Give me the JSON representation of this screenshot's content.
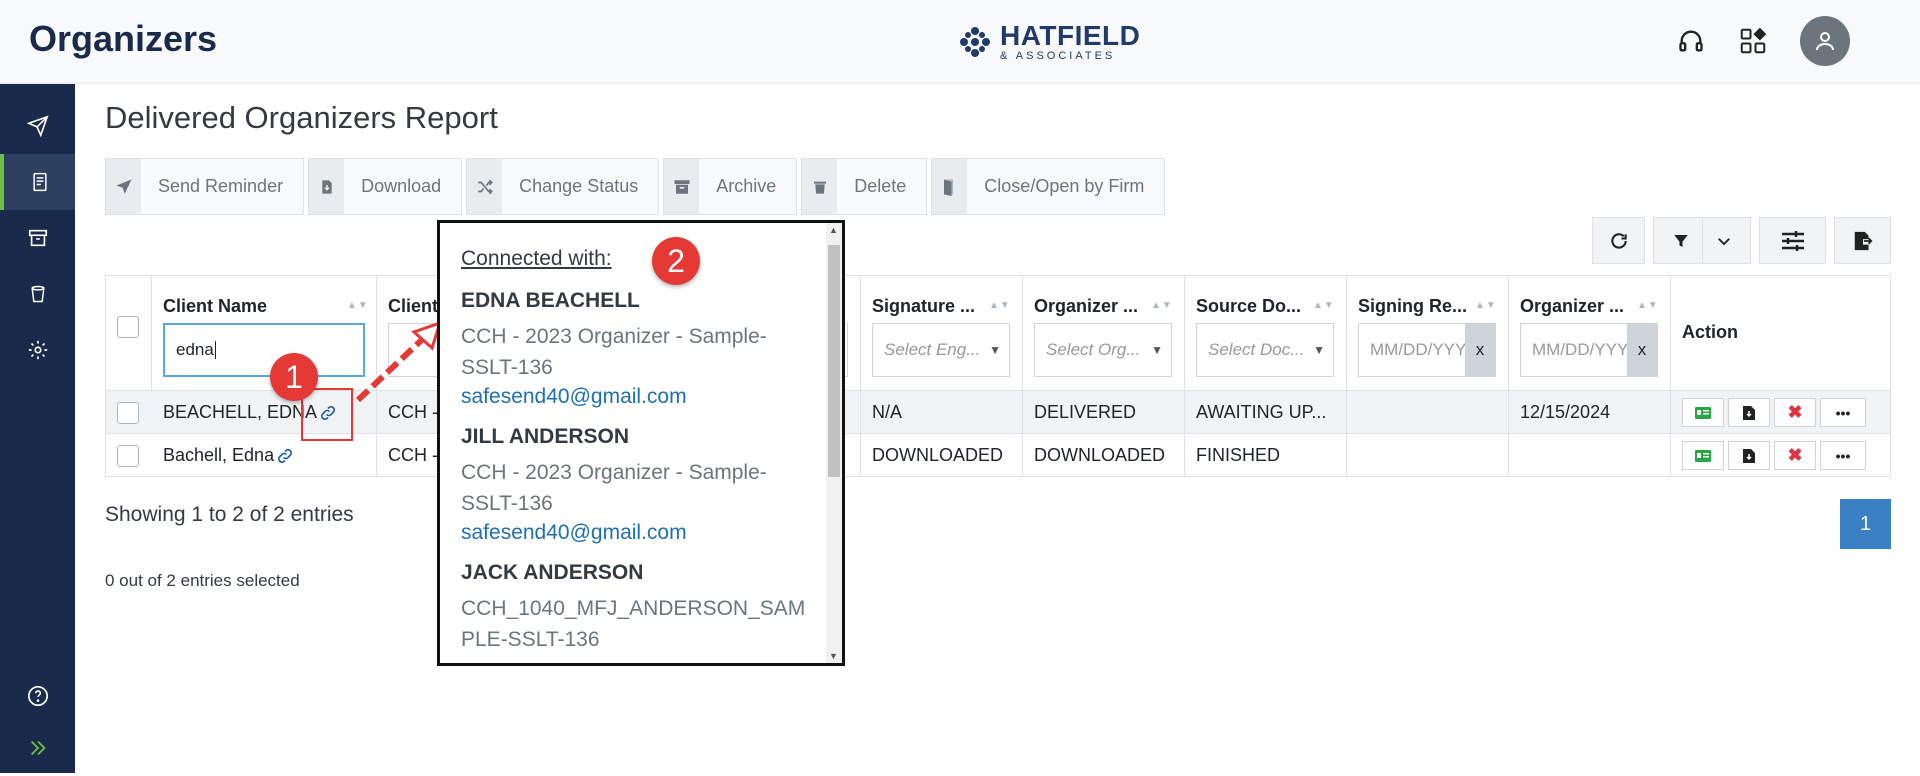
{
  "header": {
    "app_title": "Organizers",
    "logo_name": "HATFIELD",
    "logo_sub": "& ASSOCIATES"
  },
  "page_title": "Delivered Organizers Report",
  "toolbar": {
    "send_reminder": "Send Reminder",
    "download": "Download",
    "change_status": "Change Status",
    "archive": "Archive",
    "delete": "Delete",
    "close_open": "Close/Open by Firm"
  },
  "columns": {
    "client_name": "Client Name",
    "client_id": "Client",
    "signature": "Signature ...",
    "organizer_status": "Organizer ...",
    "source_doc": "Source Do...",
    "signing_reminder": "Signing Re...",
    "organizer_date": "Organizer ...",
    "action": "Action"
  },
  "filters": {
    "client_name_value": "edna",
    "signature_placeholder": "Select Eng...",
    "organizer_placeholder": "Select Org...",
    "source_placeholder": "Select Doc...",
    "date_placeholder": "MM/DD/YYY",
    "clear": "x"
  },
  "rows": [
    {
      "client_name": "BEACHELL, EDNA",
      "client_id": "CCH -",
      "signature": "N/A",
      "organizer_status": "DELIVERED",
      "source_doc": "AWAITING UP...",
      "signing_reminder": "",
      "organizer_date": "12/15/2024"
    },
    {
      "client_name": "Bachell, Edna",
      "client_id": "CCH -",
      "signature": "DOWNLOADED",
      "organizer_status": "DOWNLOADED",
      "source_doc": "FINISHED",
      "signing_reminder": "",
      "organizer_date": ""
    }
  ],
  "footer": {
    "showing": "Showing 1 to 2 of 2 entries",
    "selected": "0 out of 2 entries selected",
    "page": "1"
  },
  "popup": {
    "heading": "Connected with:",
    "entries": [
      {
        "name": "EDNA BEACHELL",
        "doc": "CCH - 2023 Organizer - Sample-SSLT-136",
        "email": "safesend40@gmail.com"
      },
      {
        "name": "JILL ANDERSON",
        "doc": "CCH - 2023 Organizer - Sample-SSLT-136",
        "email": "safesend40@gmail.com"
      },
      {
        "name": "JACK ANDERSON",
        "doc": "CCH_1040_MFJ_ANDERSON_SAMPLE-SSLT-136",
        "email": ""
      }
    ]
  },
  "annotations": {
    "badge1": "1",
    "badge2": "2"
  },
  "colors": {
    "sidebar": "#1a2a4a",
    "accent": "#6cbe45",
    "link": "#1f6fb5",
    "badge": "#e53935",
    "pager": "#3b80c2"
  }
}
